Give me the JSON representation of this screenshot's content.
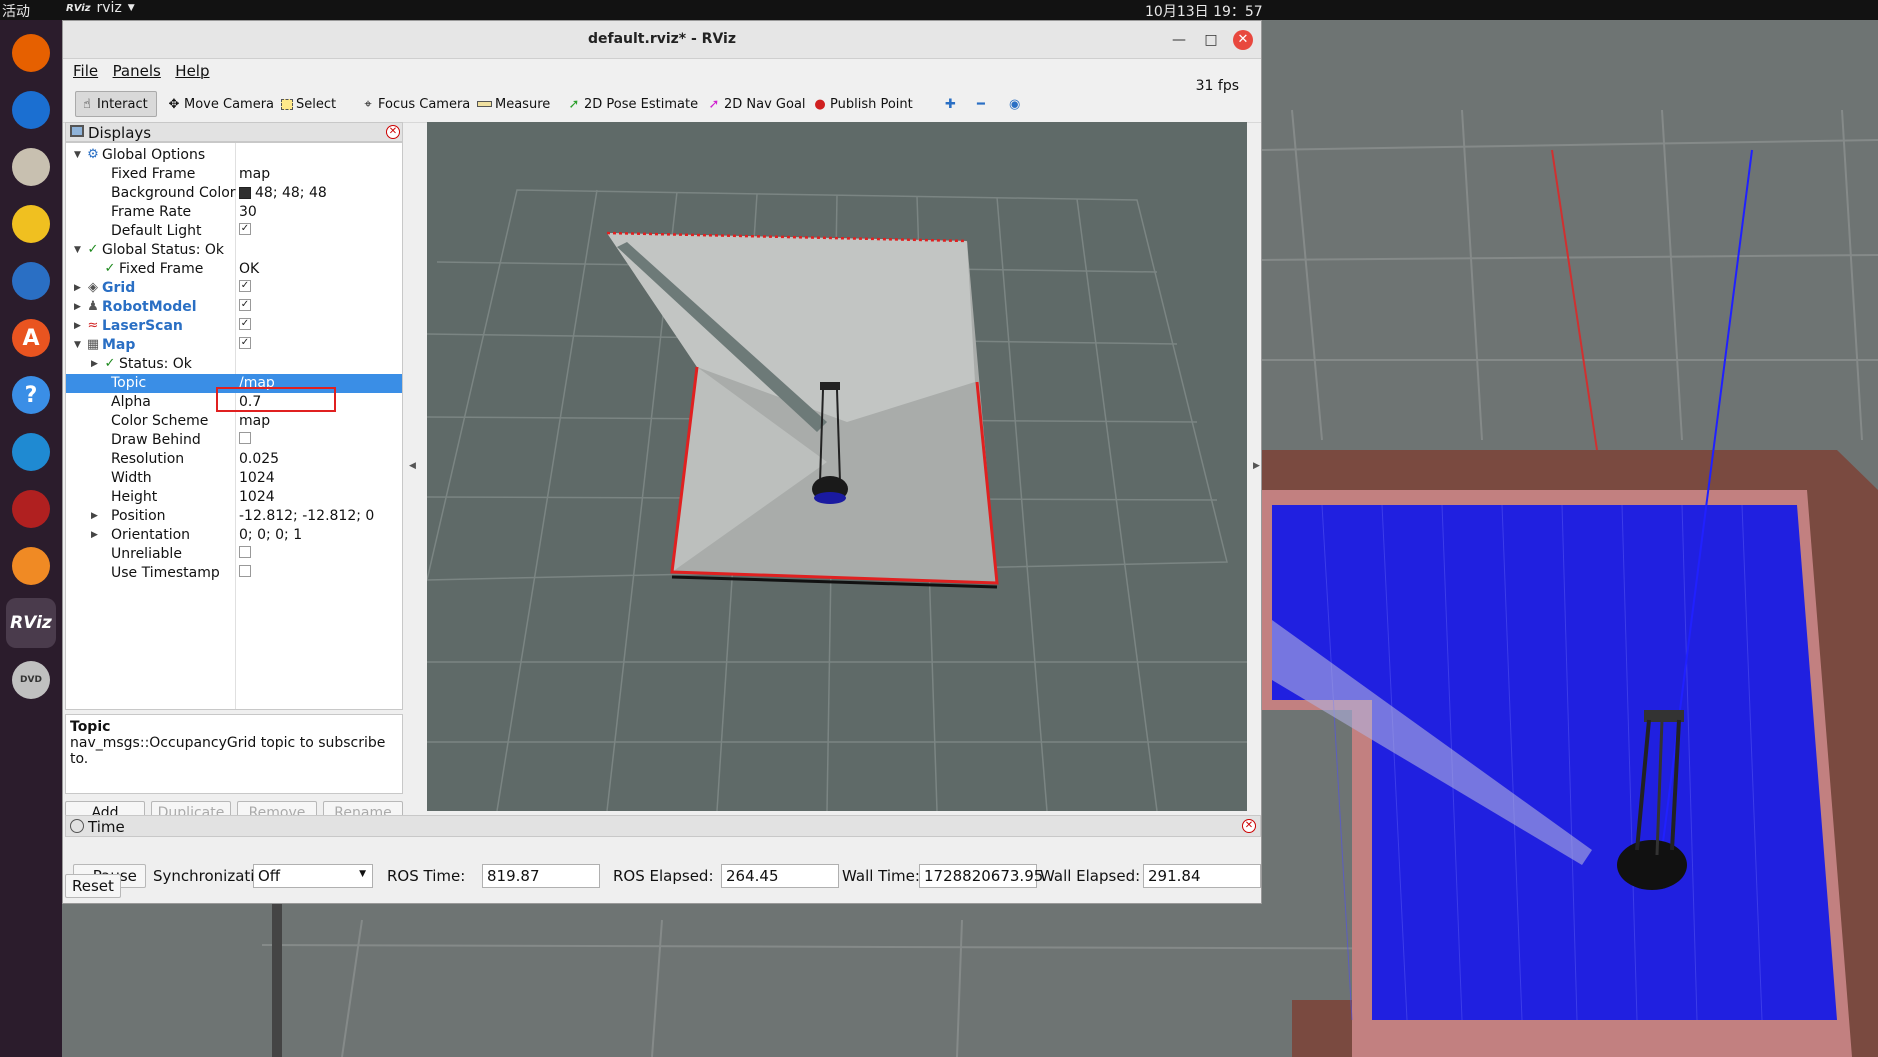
{
  "topbar": {
    "activities": "活动",
    "app_name": "rviz",
    "app_logo": "RViz",
    "clock": "10月13日 19：57"
  },
  "dock": [
    {
      "name": "firefox-icon",
      "glyph": "",
      "color": "#e66000"
    },
    {
      "name": "thunderbird-icon",
      "glyph": "",
      "color": "#1b6fd1"
    },
    {
      "name": "files-icon",
      "glyph": "",
      "color": "#c8c0b0"
    },
    {
      "name": "rhythmbox-icon",
      "glyph": "",
      "color": "#f0c020"
    },
    {
      "name": "writer-icon",
      "glyph": "",
      "color": "#2a6fc4"
    },
    {
      "name": "software-icon",
      "glyph": "A",
      "color": "#e95420"
    },
    {
      "name": "help-icon",
      "glyph": "?",
      "color": "#3a8ee6"
    },
    {
      "name": "vscode-icon",
      "glyph": "",
      "color": "#1f8ad2"
    },
    {
      "name": "terminal-icon",
      "glyph": "",
      "color": "#b02020"
    },
    {
      "name": "sublime-icon",
      "glyph": "",
      "color": "#f08a24"
    },
    {
      "name": "rviz-icon",
      "glyph": "RViz",
      "color": "#4a3b4c"
    },
    {
      "name": "dvd-icon",
      "glyph": "DVD",
      "color": "#c0c0c0"
    }
  ],
  "window": {
    "title": "default.rviz* - RViz",
    "minimize": "—",
    "maximize": "□",
    "close": "✕"
  },
  "menu": {
    "file": "File",
    "panels": "Panels",
    "help": "Help"
  },
  "toolbar": {
    "interact": "Interact",
    "move_camera": "Move Camera",
    "select": "Select",
    "focus_camera": "Focus Camera",
    "measure": "Measure",
    "pose_estimate": "2D Pose Estimate",
    "nav_goal": "2D Nav Goal",
    "publish_point": "Publish Point",
    "add_tool": "✚",
    "remove_tool": "━",
    "view_tool": "◉"
  },
  "displays": {
    "title": "Displays",
    "rows": [
      {
        "indent": 0,
        "arrow": "▼",
        "icon": "⚙",
        "icon_color": "#2a6fc4",
        "name": "Global Options",
        "value": ""
      },
      {
        "indent": 1,
        "name": "Fixed Frame",
        "value": "map"
      },
      {
        "indent": 1,
        "name": "Background Color",
        "value": "48; 48; 48"
      },
      {
        "indent": 1,
        "name": "Frame Rate",
        "value": "30"
      },
      {
        "indent": 1,
        "name": "Default Light",
        "value": "✓"
      },
      {
        "indent": 0,
        "arrow": "▼",
        "icon": "✓",
        "icon_color": "#1f8a1f",
        "name": "Global Status: Ok",
        "value": ""
      },
      {
        "indent": 1,
        "icon": "✓",
        "icon_color": "#1f8a1f",
        "name": "Fixed Frame",
        "value": "OK"
      },
      {
        "indent": 0,
        "arrow": "▶",
        "icon": "◈",
        "icon_color": "#555",
        "name": "Grid",
        "value": "✓",
        "blue": true
      },
      {
        "indent": 0,
        "arrow": "▶",
        "icon": "♟",
        "icon_color": "#555",
        "name": "RobotModel",
        "value": "✓",
        "blue": true
      },
      {
        "indent": 0,
        "arrow": "▶",
        "icon": "≈",
        "icon_color": "#d02020",
        "name": "LaserScan",
        "value": "✓",
        "blue": true
      },
      {
        "indent": 0,
        "arrow": "▼",
        "icon": "▦",
        "icon_color": "#555",
        "name": "Map",
        "value": "✓",
        "blue": true
      },
      {
        "indent": 1,
        "arrow": "▶",
        "icon": "✓",
        "icon_color": "#1f8a1f",
        "name": "Status: Ok",
        "value": ""
      },
      {
        "indent": 1,
        "name": "Topic",
        "value": "/map",
        "selected": true
      },
      {
        "indent": 1,
        "name": "Alpha",
        "value": "0.7"
      },
      {
        "indent": 1,
        "name": "Color Scheme",
        "value": "map"
      },
      {
        "indent": 1,
        "name": "Draw Behind",
        "value": ""
      },
      {
        "indent": 1,
        "name": "Resolution",
        "value": "0.025"
      },
      {
        "indent": 1,
        "name": "Width",
        "value": "1024"
      },
      {
        "indent": 1,
        "name": "Height",
        "value": "1024"
      },
      {
        "indent": 1,
        "arrow": "▶",
        "name": "Position",
        "value": "-12.812; -12.812; 0"
      },
      {
        "indent": 1,
        "arrow": "▶",
        "name": "Orientation",
        "value": "0; 0; 0; 1"
      },
      {
        "indent": 1,
        "name": "Unreliable",
        "value": ""
      },
      {
        "indent": 1,
        "name": "Use Timestamp",
        "value": ""
      }
    ],
    "description_title": "Topic",
    "description_text": "nav_msgs::OccupancyGrid topic to subscribe to.",
    "buttons": {
      "add": "Add",
      "duplicate": "Duplicate",
      "remove": "Remove",
      "rename": "Rename"
    }
  },
  "time": {
    "title": "Time",
    "pause": "Pause",
    "sync_label": "Synchronization:",
    "sync_value": "Off",
    "ros_time_label": "ROS Time:",
    "ros_time": "819.87",
    "ros_elapsed_label": "ROS Elapsed:",
    "ros_elapsed": "264.45",
    "wall_time_label": "Wall Time:",
    "wall_time": "1728820673.95",
    "wall_elapsed_label": "Wall Elapsed:",
    "wall_elapsed": "291.84",
    "reset": "Reset",
    "fps": "31 fps"
  },
  "colors": {
    "selection": "#3a8ee6",
    "highlight_box": "#e02020",
    "background": "#303030"
  }
}
